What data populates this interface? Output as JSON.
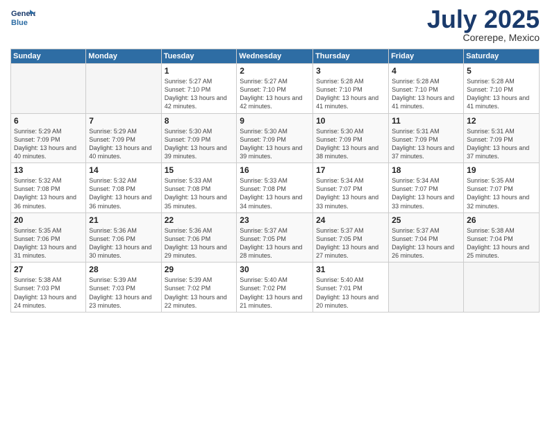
{
  "logo": {
    "line1": "General",
    "line2": "Blue"
  },
  "title": "July 2025",
  "subtitle": "Corerepe, Mexico",
  "weekdays": [
    "Sunday",
    "Monday",
    "Tuesday",
    "Wednesday",
    "Thursday",
    "Friday",
    "Saturday"
  ],
  "weeks": [
    [
      {
        "day": "",
        "info": ""
      },
      {
        "day": "",
        "info": ""
      },
      {
        "day": "1",
        "info": "Sunrise: 5:27 AM\nSunset: 7:10 PM\nDaylight: 13 hours and 42 minutes."
      },
      {
        "day": "2",
        "info": "Sunrise: 5:27 AM\nSunset: 7:10 PM\nDaylight: 13 hours and 42 minutes."
      },
      {
        "day": "3",
        "info": "Sunrise: 5:28 AM\nSunset: 7:10 PM\nDaylight: 13 hours and 41 minutes."
      },
      {
        "day": "4",
        "info": "Sunrise: 5:28 AM\nSunset: 7:10 PM\nDaylight: 13 hours and 41 minutes."
      },
      {
        "day": "5",
        "info": "Sunrise: 5:28 AM\nSunset: 7:10 PM\nDaylight: 13 hours and 41 minutes."
      }
    ],
    [
      {
        "day": "6",
        "info": "Sunrise: 5:29 AM\nSunset: 7:09 PM\nDaylight: 13 hours and 40 minutes."
      },
      {
        "day": "7",
        "info": "Sunrise: 5:29 AM\nSunset: 7:09 PM\nDaylight: 13 hours and 40 minutes."
      },
      {
        "day": "8",
        "info": "Sunrise: 5:30 AM\nSunset: 7:09 PM\nDaylight: 13 hours and 39 minutes."
      },
      {
        "day": "9",
        "info": "Sunrise: 5:30 AM\nSunset: 7:09 PM\nDaylight: 13 hours and 39 minutes."
      },
      {
        "day": "10",
        "info": "Sunrise: 5:30 AM\nSunset: 7:09 PM\nDaylight: 13 hours and 38 minutes."
      },
      {
        "day": "11",
        "info": "Sunrise: 5:31 AM\nSunset: 7:09 PM\nDaylight: 13 hours and 37 minutes."
      },
      {
        "day": "12",
        "info": "Sunrise: 5:31 AM\nSunset: 7:09 PM\nDaylight: 13 hours and 37 minutes."
      }
    ],
    [
      {
        "day": "13",
        "info": "Sunrise: 5:32 AM\nSunset: 7:08 PM\nDaylight: 13 hours and 36 minutes."
      },
      {
        "day": "14",
        "info": "Sunrise: 5:32 AM\nSunset: 7:08 PM\nDaylight: 13 hours and 36 minutes."
      },
      {
        "day": "15",
        "info": "Sunrise: 5:33 AM\nSunset: 7:08 PM\nDaylight: 13 hours and 35 minutes."
      },
      {
        "day": "16",
        "info": "Sunrise: 5:33 AM\nSunset: 7:08 PM\nDaylight: 13 hours and 34 minutes."
      },
      {
        "day": "17",
        "info": "Sunrise: 5:34 AM\nSunset: 7:07 PM\nDaylight: 13 hours and 33 minutes."
      },
      {
        "day": "18",
        "info": "Sunrise: 5:34 AM\nSunset: 7:07 PM\nDaylight: 13 hours and 33 minutes."
      },
      {
        "day": "19",
        "info": "Sunrise: 5:35 AM\nSunset: 7:07 PM\nDaylight: 13 hours and 32 minutes."
      }
    ],
    [
      {
        "day": "20",
        "info": "Sunrise: 5:35 AM\nSunset: 7:06 PM\nDaylight: 13 hours and 31 minutes."
      },
      {
        "day": "21",
        "info": "Sunrise: 5:36 AM\nSunset: 7:06 PM\nDaylight: 13 hours and 30 minutes."
      },
      {
        "day": "22",
        "info": "Sunrise: 5:36 AM\nSunset: 7:06 PM\nDaylight: 13 hours and 29 minutes."
      },
      {
        "day": "23",
        "info": "Sunrise: 5:37 AM\nSunset: 7:05 PM\nDaylight: 13 hours and 28 minutes."
      },
      {
        "day": "24",
        "info": "Sunrise: 5:37 AM\nSunset: 7:05 PM\nDaylight: 13 hours and 27 minutes."
      },
      {
        "day": "25",
        "info": "Sunrise: 5:37 AM\nSunset: 7:04 PM\nDaylight: 13 hours and 26 minutes."
      },
      {
        "day": "26",
        "info": "Sunrise: 5:38 AM\nSunset: 7:04 PM\nDaylight: 13 hours and 25 minutes."
      }
    ],
    [
      {
        "day": "27",
        "info": "Sunrise: 5:38 AM\nSunset: 7:03 PM\nDaylight: 13 hours and 24 minutes."
      },
      {
        "day": "28",
        "info": "Sunrise: 5:39 AM\nSunset: 7:03 PM\nDaylight: 13 hours and 23 minutes."
      },
      {
        "day": "29",
        "info": "Sunrise: 5:39 AM\nSunset: 7:02 PM\nDaylight: 13 hours and 22 minutes."
      },
      {
        "day": "30",
        "info": "Sunrise: 5:40 AM\nSunset: 7:02 PM\nDaylight: 13 hours and 21 minutes."
      },
      {
        "day": "31",
        "info": "Sunrise: 5:40 AM\nSunset: 7:01 PM\nDaylight: 13 hours and 20 minutes."
      },
      {
        "day": "",
        "info": ""
      },
      {
        "day": "",
        "info": ""
      }
    ]
  ],
  "colors": {
    "header_bg": "#2e6da4",
    "logo_blue": "#1a3a6b"
  }
}
